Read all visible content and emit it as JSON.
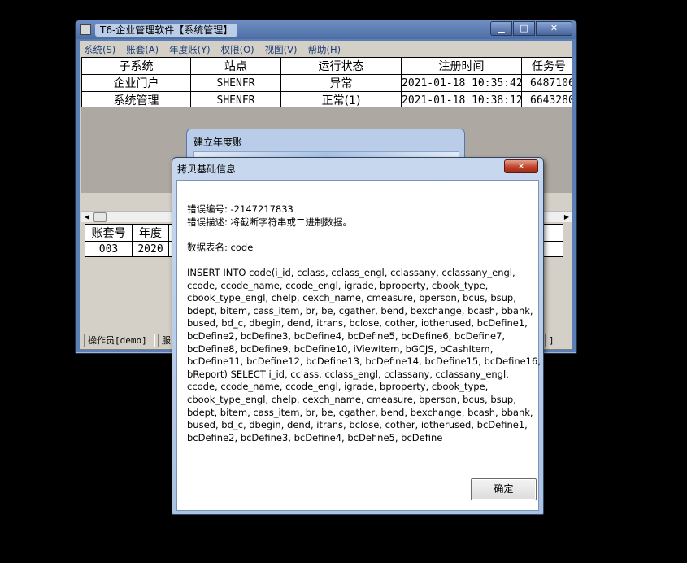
{
  "main_window": {
    "title": "T6-企业管理软件【系统管理】",
    "caption_buttons": {
      "minimize": "▁",
      "maximize": "□",
      "close": "✕"
    },
    "menu": [
      "系统(S)",
      "账套(A)",
      "年度账(Y)",
      "权限(O)",
      "视图(V)",
      "帮助(H)"
    ],
    "top_table": {
      "headers": [
        "子系统",
        "站点",
        "运行状态",
        "注册时间",
        "任务号"
      ],
      "rows": [
        [
          "企业门户",
          "SHENFR",
          "异常",
          "2021-01-18 10:35:42",
          "6487106"
        ],
        [
          "系统管理",
          "SHENFR",
          "正常(1)",
          "2021-01-18 10:38:12",
          "6643280"
        ]
      ]
    },
    "bottom_table": {
      "headers": [
        "账套号",
        "年度"
      ],
      "rows": [
        [
          "003",
          "2020"
        ]
      ]
    },
    "statusbar": [
      "操作员[demo]",
      "服"
    ]
  },
  "annual_dialog": {
    "title": "建立年度账"
  },
  "error_dialog": {
    "title": "拷贝基础信息",
    "close_label": "✕",
    "error_code_line": "错误编号: -2147217833",
    "error_desc_line": "错误描述: 将截断字符串或二进制数据。",
    "table_line": "数据表名: code",
    "sql_lines": [
      "INSERT INTO code(i_id, cclass, cclass_engl, cclassany, cclassany_engl,",
      "ccode, ccode_name, ccode_engl, igrade, bproperty, cbook_type,",
      "cbook_type_engl, chelp, cexch_name, cmeasure, bperson, bcus, bsup,",
      "bdept, bitem, cass_item, br, be, cgather, bend, bexchange, bcash, bbank,",
      "bused, bd_c, dbegin, dend, itrans, bclose, cother, iotherused, bcDefine1,",
      "bcDefine2, bcDefine3, bcDefine4, bcDefine5, bcDefine6, bcDefine7,",
      "bcDefine8, bcDefine9, bcDefine10, iViewItem, bGCJS, bCashItem,",
      "bcDefine11, bcDefine12, bcDefine13, bcDefine14, bcDefine15, bcDefine16,",
      "bReport) SELECT  i_id, cclass, cclass_engl, cclassany, cclassany_engl,",
      "ccode, ccode_name, ccode_engl, igrade, bproperty, cbook_type,",
      "cbook_type_engl, chelp, cexch_name, cmeasure, bperson, bcus, bsup,",
      "bdept, bitem, cass_item, br, be, cgather, bend, bexchange, bcash, bbank,",
      "bused, bd_c, dbegin, dend, itrans, bclose, cother, iotherused, bcDefine1,",
      "bcDefine2, bcDefine3, bcDefine4, bcDefine5, bcDefine"
    ],
    "ok_label": "确定"
  }
}
